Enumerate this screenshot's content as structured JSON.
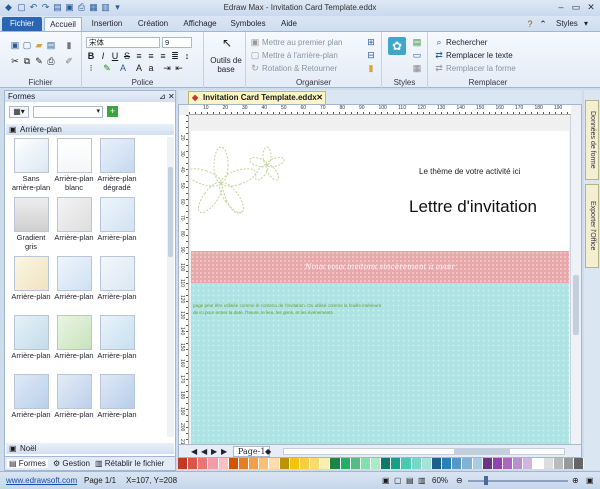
{
  "window": {
    "title": "Edraw Max - Invitation Card Template.eddx",
    "styles_label": "Styles"
  },
  "tabs": [
    "Fichier",
    "Accueil",
    "Insertion",
    "Création",
    "Affichage",
    "Symboles",
    "Aide"
  ],
  "ribbon": {
    "groups": {
      "fichier": "Fichier",
      "police": "Police",
      "organiser": "Organiser",
      "styles": "Styles",
      "remplacer": "Remplacer"
    },
    "font_name": "宋体",
    "font_size": "9",
    "outils_de_base": "Outils de base",
    "bring_front": "Mettre au premier plan",
    "send_back": "Mettre à l'arrière-plan",
    "rotation": "Rotation & Retourner",
    "find": "Rechercher",
    "replace_text": "Remplacer le texte",
    "replace_shape": "Remplacer la forme"
  },
  "left_panel": {
    "title": "Formes",
    "category": "Arrière-plan",
    "shapes": [
      "Sans arrière-plan",
      "Arrière-plan blanc",
      "Arrière-plan dégradé",
      "Gradient gris",
      "Arrière-plan",
      "Arrière-plan",
      "Arrière-plan",
      "Arrière-plan",
      "Arrière-plan",
      "Arrière-plan",
      "Arrière-plan",
      "Arrière-plan",
      "Arrière-plan",
      "Arrière-plan",
      "Arrière-plan"
    ],
    "bottom_category": "Noël",
    "bottom_tabs": [
      "Formes",
      "Gestion",
      "Rétablir le fichier"
    ]
  },
  "right_tabs": [
    "Données de forme",
    "Exporter l'Office"
  ],
  "document": {
    "tab_title": "Invitation Card Template.eddx",
    "activity_text": "Le thème de votre activité ici",
    "heading": "Lettre d'invitation",
    "band_text": "Nous vous invitons sincèrement à avoir",
    "body_line1": "page peut être utilisée comme le contenu de l'invitation. Ou utilisé comme la feuille intérieure",
    "body_line2": "de ici pour entrer la date, l'heure, le lieu, les gens, et les événements",
    "page_tab": "Page-1",
    "ruler_h": [
      "10",
      "20",
      "30",
      "40",
      "50",
      "60",
      "70",
      "80",
      "90",
      "100",
      "110",
      "120",
      "130",
      "140",
      "150",
      "160",
      "170",
      "180",
      "190"
    ],
    "ruler_v": [
      "20",
      "30",
      "40",
      "50",
      "60",
      "70",
      "80",
      "90",
      "100",
      "110",
      "120",
      "130",
      "140",
      "150",
      "160",
      "170",
      "180",
      "190",
      "200",
      "210"
    ]
  },
  "palette": [
    "#c0392b",
    "#d9534f",
    "#e8737a",
    "#f29ca3",
    "#f7c0c4",
    "#d35400",
    "#e67e22",
    "#f0a04b",
    "#f5c07a",
    "#f9dfae",
    "#b7950b",
    "#f1c40f",
    "#f4d03f",
    "#f7dc6f",
    "#fbeeb5",
    "#1e8449",
    "#27ae60",
    "#52be80",
    "#82e0aa",
    "#abebc6",
    "#117a65",
    "#16a085",
    "#48c9b0",
    "#76d7c4",
    "#a3e4d7",
    "#1f618d",
    "#2980b9",
    "#5499c7",
    "#7fb3d5",
    "#a9cce3",
    "#6c3483",
    "#8e44ad",
    "#a569bd",
    "#bb8fce",
    "#d2b4de",
    "#ffffff",
    "#dddddd",
    "#bbbbbb",
    "#999999",
    "#666666"
  ],
  "status": {
    "website": "www.edrawsoft.com",
    "page": "Page 1/1",
    "coords": "X=107, Y=208",
    "zoom": "60%"
  }
}
